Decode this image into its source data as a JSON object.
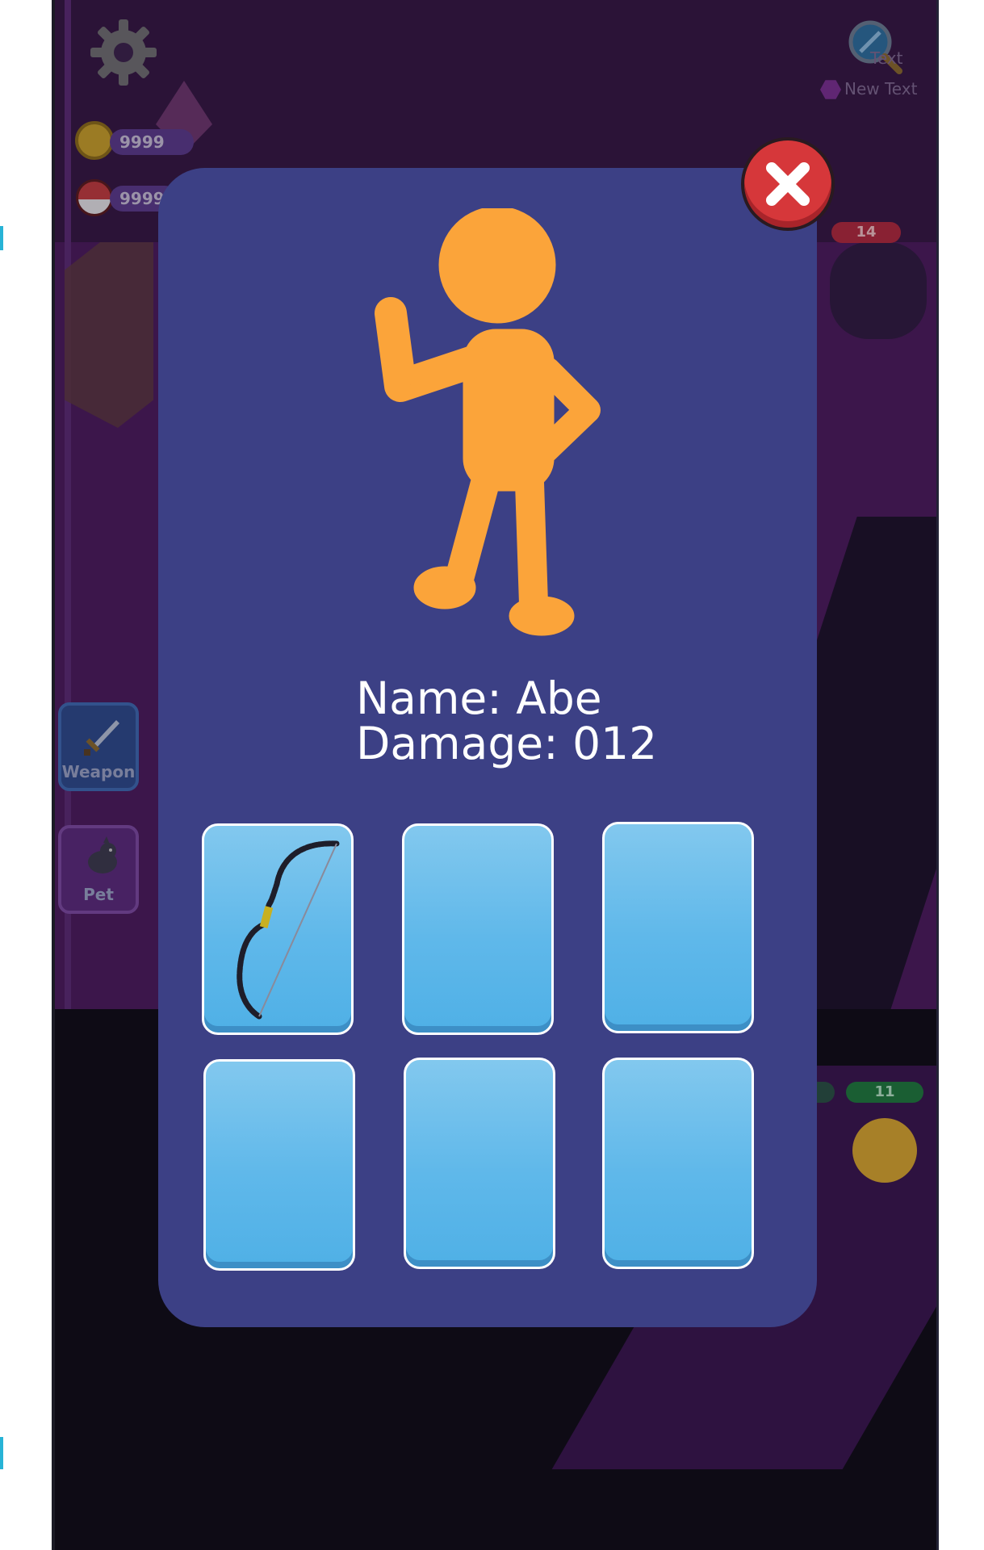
{
  "hud": {
    "coins": "9999",
    "gems": "9999",
    "new_text_top": "Text",
    "new_text": "New Text"
  },
  "side_buttons": {
    "weapon_label": "Weapon",
    "pet_label": "Pet"
  },
  "enemies": {
    "hp_top": "14",
    "hp_bottom": "11",
    "hp_bottom_faded": "11"
  },
  "character": {
    "name_text": "Name: Abe",
    "damage_text": "Damage: 012"
  },
  "inventory": {
    "slots": [
      {
        "item": "bow-icon"
      },
      {
        "item": ""
      },
      {
        "item": ""
      },
      {
        "item": ""
      },
      {
        "item": ""
      },
      {
        "item": ""
      }
    ]
  },
  "colors": {
    "modal_bg": "#3c4085",
    "character_silhouette": "#fba43a",
    "slot_top": "#82c8ee",
    "slot_bottom": "#4fb0e6",
    "close_button": "#d6373a"
  }
}
